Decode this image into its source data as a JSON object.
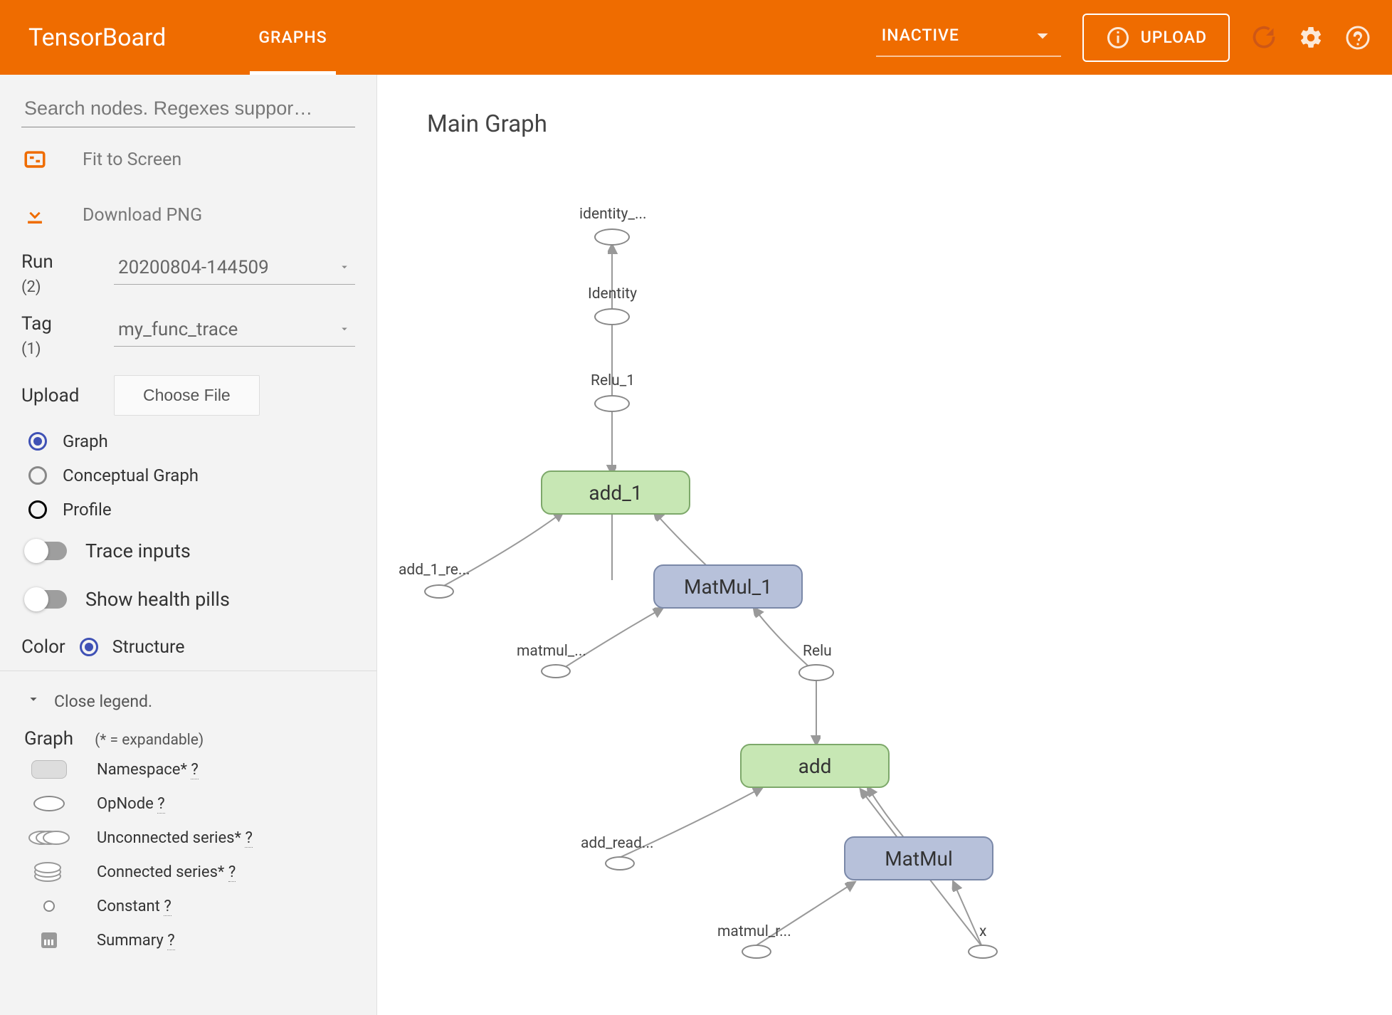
{
  "header": {
    "title": "TensorBoard",
    "tab": "GRAPHS",
    "inactive": "INACTIVE",
    "upload": "UPLOAD"
  },
  "sidebar": {
    "search_placeholder": "Search nodes. Regexes suppor…",
    "fit": "Fit to Screen",
    "download": "Download PNG",
    "run_label": "Run",
    "run_count": "(2)",
    "run_value": "20200804-144509",
    "tag_label": "Tag",
    "tag_count": "(1)",
    "tag_value": "my_func_trace",
    "upload_label": "Upload",
    "choose_file": "Choose File",
    "radios": {
      "graph": "Graph",
      "conceptual": "Conceptual Graph",
      "profile": "Profile"
    },
    "toggles": {
      "trace": "Trace inputs",
      "health": "Show health pills"
    },
    "color_label": "Color",
    "color_value": "Structure",
    "legend": {
      "close": "Close legend.",
      "graph_title": "Graph",
      "hint": "(* = expandable)",
      "items": {
        "namespace": "Namespace* ",
        "opnode": "OpNode ",
        "unseries": "Unconnected series* ",
        "cseries": "Connected series* ",
        "constant": "Constant ",
        "summary": "Summary "
      },
      "q": "?"
    }
  },
  "graph": {
    "title": "Main Graph",
    "nodes": {
      "identity_ret": "identity_...",
      "identity": "Identity",
      "relu1": "Relu_1",
      "add1": "add_1",
      "add1_re": "add_1_re...",
      "matmul1": "MatMul_1",
      "matmul_dots": "matmul_...",
      "relu": "Relu",
      "add": "add",
      "add_read": "add_read...",
      "matmul": "MatMul",
      "matmul_r": "matmul_r...",
      "x": "x"
    }
  }
}
